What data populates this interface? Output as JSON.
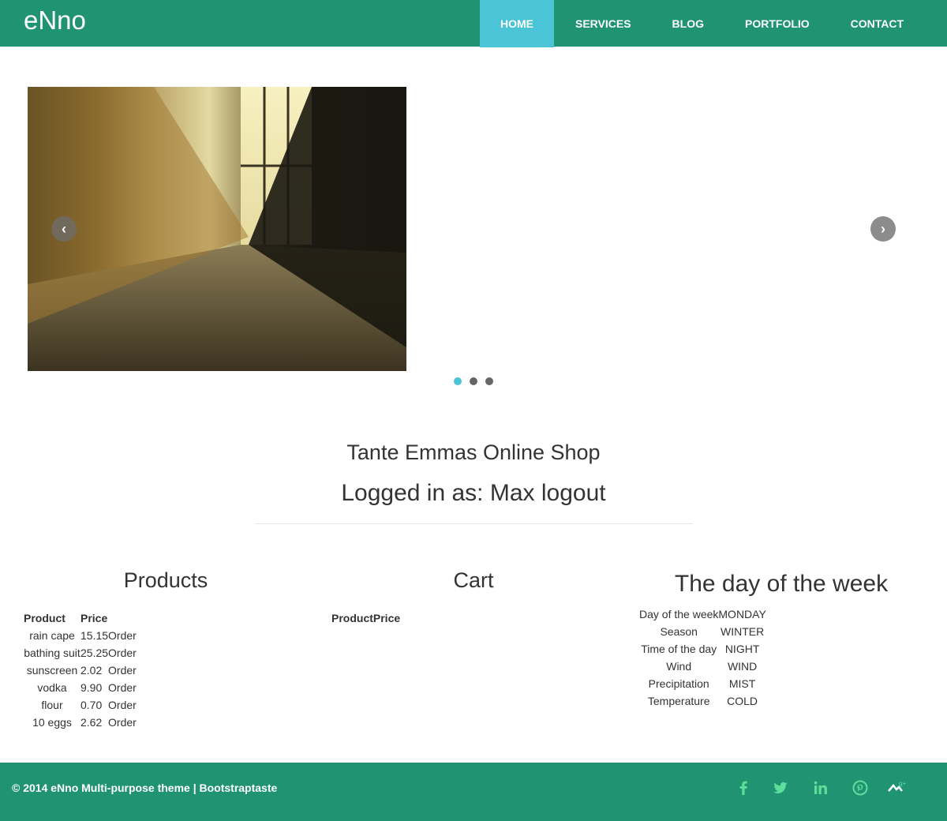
{
  "nav": {
    "brand": "eNno",
    "items": [
      {
        "label": "HOME",
        "active": true
      },
      {
        "label": "SERVICES"
      },
      {
        "label": "BLOG"
      },
      {
        "label": "PORTFOLIO"
      },
      {
        "label": "CONTACT"
      }
    ]
  },
  "carousel": {
    "prev_icon": "chevron-left-icon",
    "next_icon": "chevron-right-icon",
    "indicator_count": 3,
    "active_index": 0
  },
  "shop": {
    "title": "Tante Emmas Online Shop",
    "logged_prefix": "Logged in as: ",
    "user": "Max",
    "logout": "logout"
  },
  "products": {
    "title": "Products",
    "headers": [
      "Product",
      "Price"
    ],
    "rows": [
      {
        "name": "rain cape",
        "price": "15.15",
        "action": "Order"
      },
      {
        "name": "bathing suit",
        "price": "25.25",
        "action": "Order"
      },
      {
        "name": "sunscreen",
        "price": "2.02",
        "action": "Order"
      },
      {
        "name": "vodka",
        "price": "9.90",
        "action": "Order"
      },
      {
        "name": "flour",
        "price": "0.70",
        "action": "Order"
      },
      {
        "name": "10 eggs",
        "price": "2.62",
        "action": "Order"
      }
    ]
  },
  "cart": {
    "title": "Cart",
    "headers": [
      "Product",
      "Price"
    ]
  },
  "week": {
    "title": "The day of the week",
    "rows": [
      {
        "label": "Day of the week",
        "value": "MONDAY"
      },
      {
        "label": "Season",
        "value": "WINTER"
      },
      {
        "label": "Time of the day",
        "value": "NIGHT"
      },
      {
        "label": "Wind",
        "value": "WIND"
      },
      {
        "label": "Precipitation",
        "value": "MIST"
      },
      {
        "label": "Temperature",
        "value": "COLD"
      }
    ]
  },
  "footer": {
    "copyright": "© 2014 eNno Multi-purpose theme | Bootstraptaste",
    "social_icons": [
      "facebook-icon",
      "twitter-icon",
      "linkedin-icon",
      "pinterest-icon",
      "google-plus-icon"
    ]
  },
  "colors": {
    "brand_green": "#209373",
    "accent_cyan": "#4ac4d6",
    "social_icon": "#5ddf9b"
  }
}
